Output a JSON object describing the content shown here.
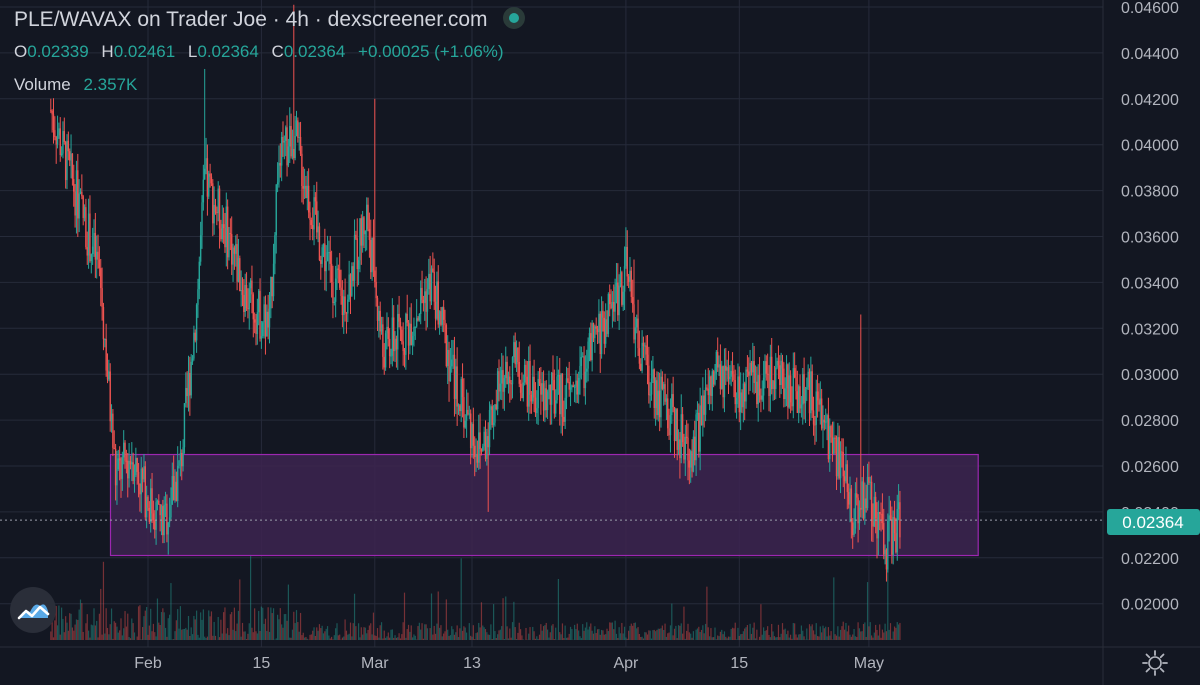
{
  "header": {
    "symbol": "PLE/WAVAX on Trader Joe",
    "interval": "4h",
    "source": "dexscreener.com"
  },
  "ohlc": {
    "o_label": "O",
    "o": "0.02339",
    "h_label": "H",
    "h": "0.02461",
    "l_label": "L",
    "l": "0.02364",
    "c_label": "C",
    "c": "0.02364",
    "change": "+0.00025 (+1.06%)"
  },
  "volume": {
    "label": "Volume",
    "value": "2.357K"
  },
  "colors": {
    "background": "#131722",
    "grid": "#262b3a",
    "up": "#26a69a",
    "down": "#ef5350",
    "zone_fill": "#3d2450",
    "zone_border": "#9c27b0",
    "price_tag": "#26a69a",
    "axis_text": "#b2b5be"
  },
  "icons": {
    "logo": "dexscreener-logo-icon",
    "settings": "gear-icon",
    "live": "live-status-dot-icon"
  },
  "chart_data": {
    "type": "candlestick",
    "y_ticks": [
      "0.04600",
      "0.04400",
      "0.04200",
      "0.04000",
      "0.03800",
      "0.03600",
      "0.03400",
      "0.03200",
      "0.03000",
      "0.02800",
      "0.02600",
      "0.02400",
      "0.02200",
      "0.02000"
    ],
    "y_range": [
      0.0188,
      0.0461
    ],
    "x_ticks": [
      "Feb",
      "15",
      "Mar",
      "13",
      "Apr",
      "15",
      "May"
    ],
    "last_price": "0.02364",
    "support_zone": {
      "low": 0.0221,
      "high": 0.0265
    },
    "grid": true,
    "anchors": [
      {
        "x": "Jan 20",
        "y": 0.0415
      },
      {
        "x": "Jan 23",
        "y": 0.038
      },
      {
        "x": "Jan 26",
        "y": 0.0345
      },
      {
        "x": "Jan 28",
        "y": 0.0255
      },
      {
        "x": "Jan 30",
        "y": 0.0265
      },
      {
        "x": "Feb 1",
        "y": 0.0245
      },
      {
        "x": "Feb 3",
        "y": 0.0235
      },
      {
        "x": "Feb 5",
        "y": 0.026
      },
      {
        "x": "Feb 7",
        "y": 0.033
      },
      {
        "x": "Feb 8",
        "y": 0.0385
      },
      {
        "x": "Feb 11",
        "y": 0.036
      },
      {
        "x": "Feb 13",
        "y": 0.0335
      },
      {
        "x": "Feb 16",
        "y": 0.032
      },
      {
        "x": "Feb 17",
        "y": 0.039
      },
      {
        "x": "Feb 19",
        "y": 0.0405
      },
      {
        "x": "Feb 22",
        "y": 0.036
      },
      {
        "x": "Feb 25",
        "y": 0.033
      },
      {
        "x": "Feb 28",
        "y": 0.037
      },
      {
        "x": "Mar 2",
        "y": 0.031
      },
      {
        "x": "Mar 5",
        "y": 0.032
      },
      {
        "x": "Mar 8",
        "y": 0.034
      },
      {
        "x": "Mar 11",
        "y": 0.0295
      },
      {
        "x": "Mar 14",
        "y": 0.0265
      },
      {
        "x": "Mar 16",
        "y": 0.029
      },
      {
        "x": "Mar 18",
        "y": 0.0305
      },
      {
        "x": "Mar 21",
        "y": 0.029
      },
      {
        "x": "Mar 25",
        "y": 0.029
      },
      {
        "x": "Mar 29",
        "y": 0.032
      },
      {
        "x": "Apr 1",
        "y": 0.0345
      },
      {
        "x": "Apr 3",
        "y": 0.0305
      },
      {
        "x": "Apr 6",
        "y": 0.0285
      },
      {
        "x": "Apr 9",
        "y": 0.0265
      },
      {
        "x": "Apr 12",
        "y": 0.03
      },
      {
        "x": "Apr 15",
        "y": 0.029
      },
      {
        "x": "Apr 18",
        "y": 0.03
      },
      {
        "x": "Apr 21",
        "y": 0.0295
      },
      {
        "x": "Apr 24",
        "y": 0.029
      },
      {
        "x": "Apr 27",
        "y": 0.0265
      },
      {
        "x": "Apr 29",
        "y": 0.024
      },
      {
        "x": "May 1",
        "y": 0.025
      },
      {
        "x": "May 3",
        "y": 0.0225
      },
      {
        "x": "May 5",
        "y": 0.0236
      }
    ],
    "spikes": [
      {
        "x": "Feb 19",
        "high": 0.0461
      },
      {
        "x": "Feb 8",
        "high": 0.0433
      },
      {
        "x": "Mar 1",
        "high": 0.042
      },
      {
        "x": "Apr 30",
        "high": 0.0326
      },
      {
        "x": "Apr 2",
        "high": 0.035
      },
      {
        "x": "Mar 15",
        "low": 0.024
      }
    ]
  }
}
